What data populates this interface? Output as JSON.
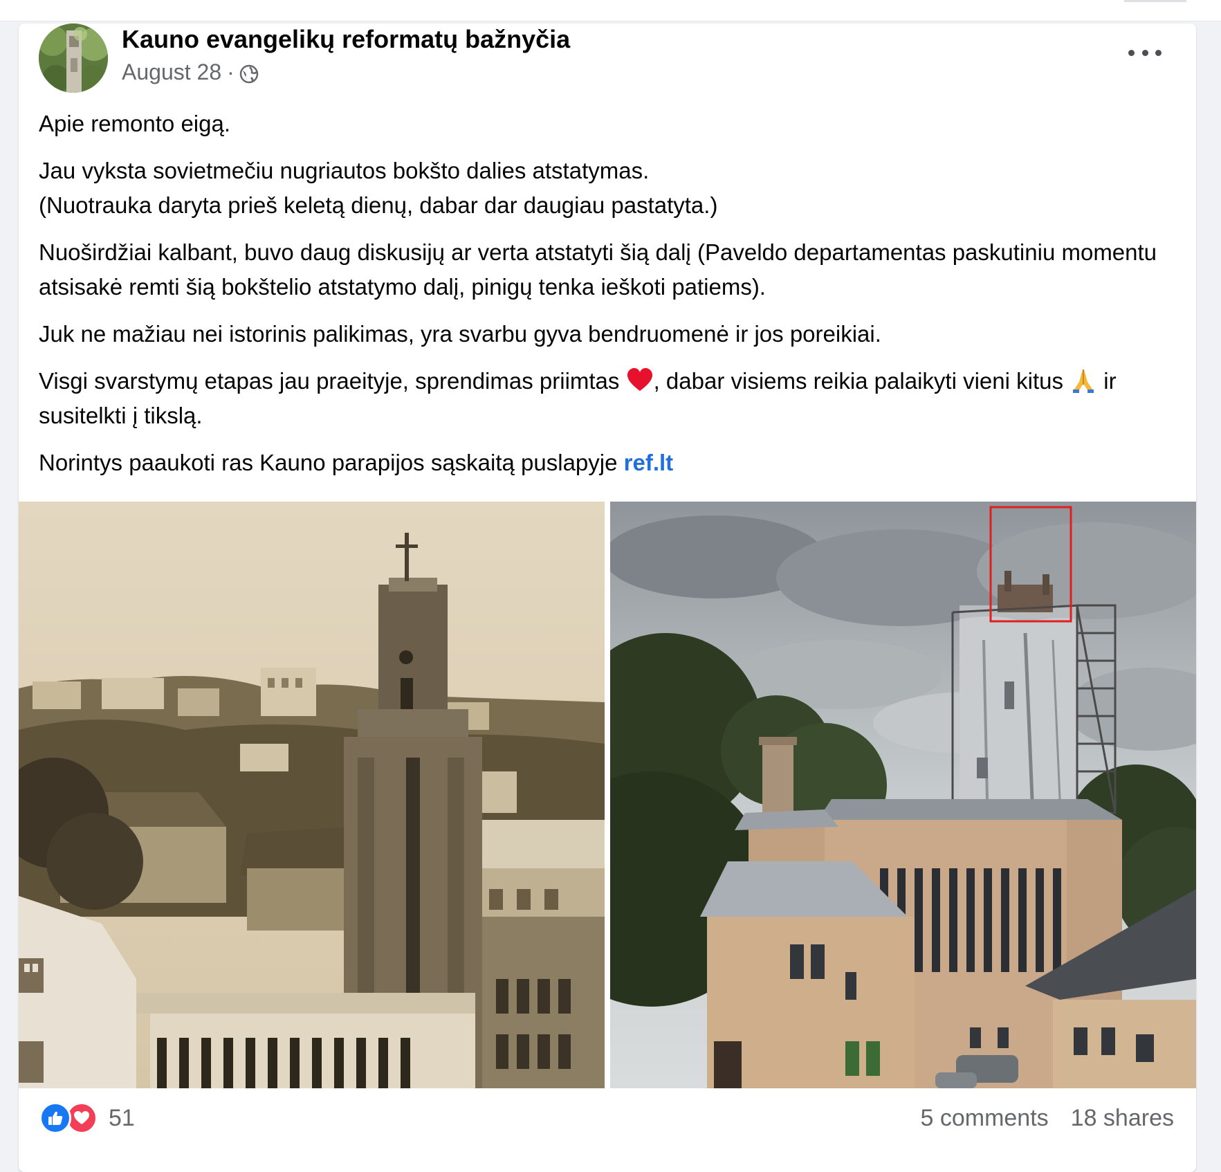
{
  "post": {
    "page_name": "Kauno evangelikų reformatų bažnyčia",
    "date": "August 28",
    "separator": "·",
    "privacy_icon": "globe-icon",
    "more_icon": "more-options-icon",
    "paragraphs": {
      "p1": "Apie remonto eigą.",
      "p2_line1": "Jau vyksta sovietmečiu nugriautos bokšto dalies atstatymas.",
      "p2_line2": "(Nuotrauka daryta prieš keletą dienų, dabar dar daugiau pastatyta.)",
      "p3": "Nuoširdžiai kalbant, buvo daug diskusijų ar verta atstatyti šią dalį (Paveldo departamentas paskutiniu momentu atsisakė remti šią bokštelio atstatymo dalį, pinigų tenka ieškoti patiems).",
      "p4": "Juk ne mažiau nei istorinis palikimas, yra svarbu gyva bendruomenė ir jos poreikiai.",
      "p5_part1": "Visgi svarstymų etapas jau praeityje, sprendimas priimtas ",
      "p5_part2": ", dabar visiems reikia palaikyti vieni kitus ",
      "p5_part3": " ir susitelkti į tikslą.",
      "p6_text": "Norintys paaukoti ras Kauno parapijos sąskaitą puslapyje ",
      "p6_link": "ref.lt"
    },
    "emoji": {
      "heart": "red-heart-emoji",
      "pray": "folded-hands-emoji"
    },
    "photos": [
      {
        "name": "historic-church-photo",
        "style": "sepia"
      },
      {
        "name": "church-renovation-photo",
        "style": "color",
        "highlight_color": "#e02020"
      }
    ],
    "footer": {
      "reaction_icons": [
        "like-icon",
        "love-icon"
      ],
      "reaction_count": "51",
      "comments": "5 comments",
      "shares": "18 shares"
    },
    "colors": {
      "link": "#216fdb",
      "like": "#1877f2",
      "love": "#f33e58"
    }
  }
}
